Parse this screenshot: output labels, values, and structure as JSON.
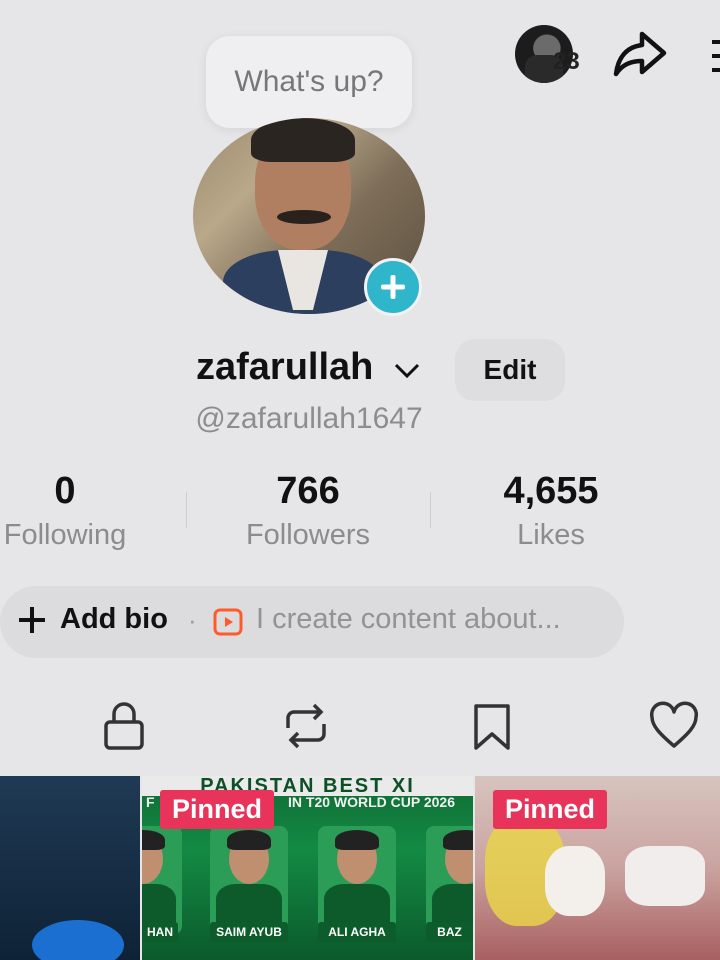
{
  "header": {
    "notification_count": "23",
    "icons": [
      "avatar-story",
      "share-icon",
      "menu-icon"
    ]
  },
  "note": {
    "text": "What's up?"
  },
  "profile": {
    "username": "zafarullah",
    "handle": "@zafarullah1647",
    "edit_label": "Edit"
  },
  "stats": [
    {
      "value": "0",
      "label": "Following"
    },
    {
      "value": "766",
      "label": "Followers"
    },
    {
      "value": "4,655",
      "label": "Likes"
    }
  ],
  "bio": {
    "add_bio_label": "Add bio",
    "separator": "·",
    "placeholder": "I create content about..."
  },
  "tabs": [
    "lock-icon",
    "repost-icon",
    "bookmark-icon",
    "heart-icon"
  ],
  "grid": {
    "pinned_label": "Pinned",
    "tile2_banner": "PAKISTAN BEST XI",
    "tile2_subtitle": "IN T20 WORLD CUP 2026",
    "tile2_prefix": "F",
    "players": [
      "HAN",
      "SAIM AYUB",
      "ALI AGHA",
      "BAZ"
    ]
  },
  "colors": {
    "background": "#e6e6e8",
    "accent_teal": "#2fb6cb",
    "pinned_red": "#e8345a",
    "bio_icon_orange": "#ff5a2a"
  }
}
